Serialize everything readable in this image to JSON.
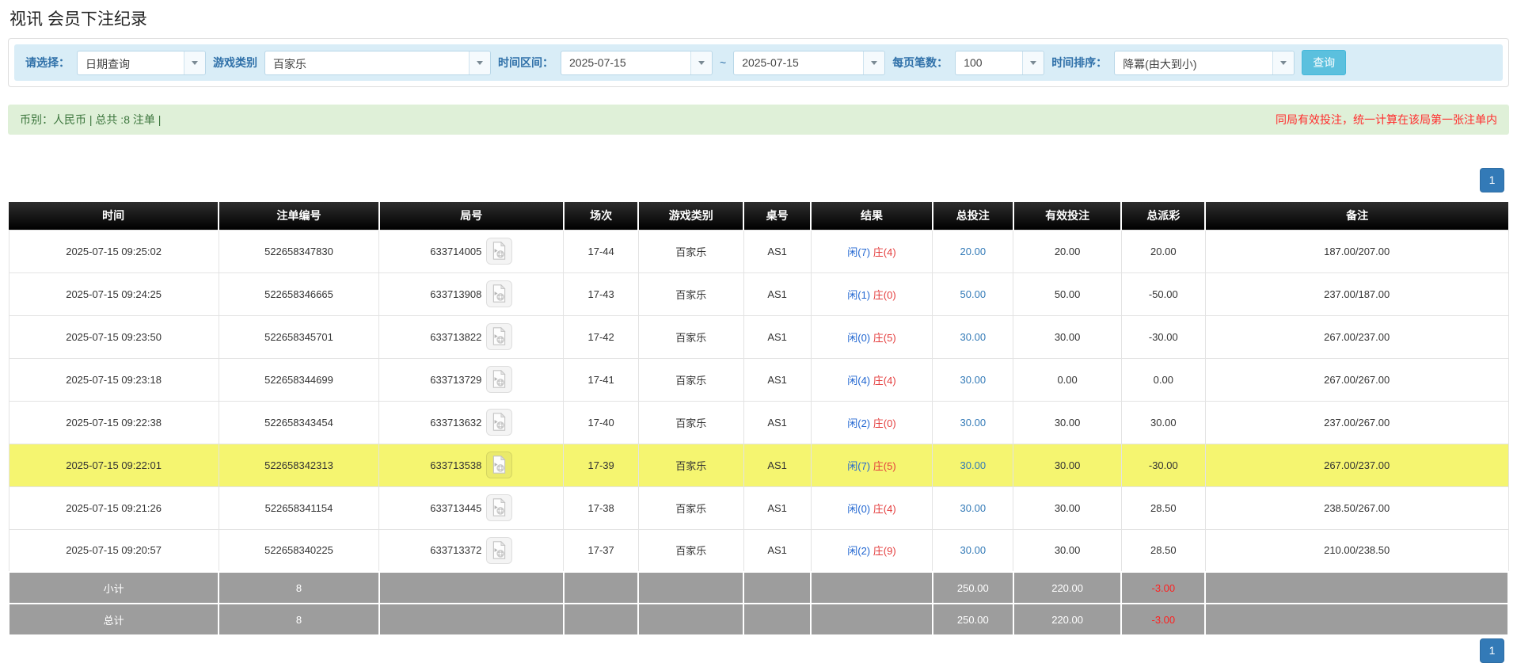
{
  "page": {
    "title": "视讯 会员下注纪录"
  },
  "colors": {
    "filter_bar_bg": "#d9edf7",
    "filter_label": "#3071a9",
    "search_button": "#5bc0de",
    "summary_bg": "#dff0d8",
    "summary_text": "#3c763d",
    "warning_red": "#ff2d2d",
    "header_bg": "#000000",
    "highlight_yellow": "#f5f570",
    "player_blue": "#2166d1",
    "banker_red": "#e43c3c",
    "link_blue": "#337ab7",
    "negative_red": "#ff1515",
    "footer_grey": "#9d9d9d",
    "pagination_blue": "#337ab7"
  },
  "filters": {
    "select_label": "请选择：",
    "select_value": "日期查询",
    "game_label": "游戏类别",
    "game_value": "百家乐",
    "range_label": "时间区间：",
    "date_from": "2025-07-15",
    "tilde": "~",
    "date_to": "2025-07-15",
    "per_page_label": "每页笔数：",
    "per_page_value": "100",
    "sort_label": "时间排序：",
    "sort_value": "降冪(由大到小)",
    "search_button": "查询"
  },
  "summary": {
    "left": "币别：人民币 | 总共 :8 注单 |",
    "right": "同局有效投注，统一计算在该局第一张注单内"
  },
  "pagination": {
    "page": "1"
  },
  "table": {
    "headers": [
      "时间",
      "注单编号",
      "局号",
      "场次",
      "游戏类别",
      "桌号",
      "结果",
      "总投注",
      "有效投注",
      "总派彩",
      "备注"
    ],
    "rows": [
      {
        "time": "2025-07-15 09:25:02",
        "bet_id": "522658347830",
        "round_id": "633714005",
        "session": "17-44",
        "game": "百家乐",
        "table_no": "AS1",
        "result_player": "闲(7)",
        "result_banker": "庄(4)",
        "total_bet": "20.00",
        "valid_bet": "20.00",
        "payout": "20.00",
        "note": "187.00/207.00",
        "highlight": false
      },
      {
        "time": "2025-07-15 09:24:25",
        "bet_id": "522658346665",
        "round_id": "633713908",
        "session": "17-43",
        "game": "百家乐",
        "table_no": "AS1",
        "result_player": "闲(1)",
        "result_banker": "庄(0)",
        "total_bet": "50.00",
        "valid_bet": "50.00",
        "payout": "-50.00",
        "note": "237.00/187.00",
        "highlight": false
      },
      {
        "time": "2025-07-15 09:23:50",
        "bet_id": "522658345701",
        "round_id": "633713822",
        "session": "17-42",
        "game": "百家乐",
        "table_no": "AS1",
        "result_player": "闲(0)",
        "result_banker": "庄(5)",
        "total_bet": "30.00",
        "valid_bet": "30.00",
        "payout": "-30.00",
        "note": "267.00/237.00",
        "highlight": false
      },
      {
        "time": "2025-07-15 09:23:18",
        "bet_id": "522658344699",
        "round_id": "633713729",
        "session": "17-41",
        "game": "百家乐",
        "table_no": "AS1",
        "result_player": "闲(4)",
        "result_banker": "庄(4)",
        "total_bet": "30.00",
        "valid_bet": "0.00",
        "payout": "0.00",
        "note": "267.00/267.00",
        "highlight": false
      },
      {
        "time": "2025-07-15 09:22:38",
        "bet_id": "522658343454",
        "round_id": "633713632",
        "session": "17-40",
        "game": "百家乐",
        "table_no": "AS1",
        "result_player": "闲(2)",
        "result_banker": "庄(0)",
        "total_bet": "30.00",
        "valid_bet": "30.00",
        "payout": "30.00",
        "note": "237.00/267.00",
        "highlight": false
      },
      {
        "time": "2025-07-15 09:22:01",
        "bet_id": "522658342313",
        "round_id": "633713538",
        "session": "17-39",
        "game": "百家乐",
        "table_no": "AS1",
        "result_player": "闲(7)",
        "result_banker": "庄(5)",
        "total_bet": "30.00",
        "valid_bet": "30.00",
        "payout": "-30.00",
        "note": "267.00/237.00",
        "highlight": true
      },
      {
        "time": "2025-07-15 09:21:26",
        "bet_id": "522658341154",
        "round_id": "633713445",
        "session": "17-38",
        "game": "百家乐",
        "table_no": "AS1",
        "result_player": "闲(0)",
        "result_banker": "庄(4)",
        "total_bet": "30.00",
        "valid_bet": "30.00",
        "payout": "28.50",
        "note": "238.50/267.00",
        "highlight": false
      },
      {
        "time": "2025-07-15 09:20:57",
        "bet_id": "522658340225",
        "round_id": "633713372",
        "session": "17-37",
        "game": "百家乐",
        "table_no": "AS1",
        "result_player": "闲(2)",
        "result_banker": "庄(9)",
        "total_bet": "30.00",
        "valid_bet": "30.00",
        "payout": "28.50",
        "note": "210.00/238.50",
        "highlight": false
      }
    ],
    "footer": [
      {
        "label": "小计",
        "count": "8",
        "total_bet": "250.00",
        "valid_bet": "220.00",
        "payout": "-3.00"
      },
      {
        "label": "总计",
        "count": "8",
        "total_bet": "250.00",
        "valid_bet": "220.00",
        "payout": "-3.00"
      }
    ]
  }
}
